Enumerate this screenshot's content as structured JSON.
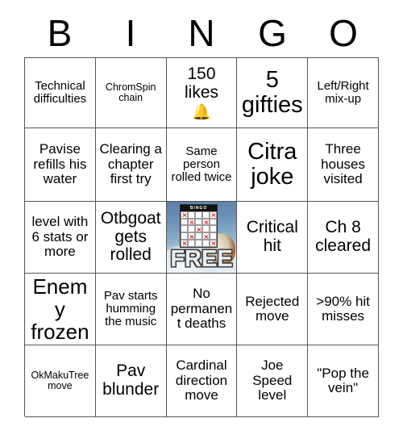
{
  "card": {
    "header_letters": [
      "B",
      "I",
      "N",
      "G",
      "O"
    ],
    "rows": [
      [
        {
          "text": "Technical difficulties",
          "size": "s"
        },
        {
          "text": "ChromSpin chain",
          "size": "xs"
        },
        {
          "text": "150 likes",
          "size": "l",
          "emoji": "🔔",
          "emoji_name": "bell-emoji"
        },
        {
          "text": "5 gifties",
          "size": "xxl"
        },
        {
          "text": "Left/Right mix-up",
          "size": "s"
        }
      ],
      [
        {
          "text": "Pavise refills his water",
          "size": "m"
        },
        {
          "text": "Clearing a chapter first try",
          "size": "m"
        },
        {
          "text": "Same person rolled twice",
          "size": "s"
        },
        {
          "text": "Citra joke",
          "size": "xxl"
        },
        {
          "text": "Three houses visited",
          "size": "m"
        }
      ],
      [
        {
          "text": "level with 6 stats or more",
          "size": "m"
        },
        {
          "text": "Otbgoat gets rolled",
          "size": "l"
        },
        {
          "text": "FREE",
          "size": "free",
          "free_space": true
        },
        {
          "text": "Critical hit",
          "size": "l"
        },
        {
          "text": "Ch 8 cleared",
          "size": "l"
        }
      ],
      [
        {
          "text": "Enemy frozen",
          "size": "xl"
        },
        {
          "text": "Pav starts humming the music",
          "size": "s"
        },
        {
          "text": "No permanent deaths",
          "size": "m"
        },
        {
          "text": "Rejected move",
          "size": "m"
        },
        {
          "text": ">90% hit misses",
          "size": "m"
        }
      ],
      [
        {
          "text": "OkMakuTree move",
          "size": "xs"
        },
        {
          "text": "Pav blunder",
          "size": "l"
        },
        {
          "text": "Cardinal direction move",
          "size": "m"
        },
        {
          "text": "Joe Speed level",
          "size": "m"
        },
        {
          "text": "\"Pop the vein\"",
          "size": "m"
        }
      ]
    ],
    "free_space": {
      "label": "FREE",
      "mini_card_header": "BINGO",
      "marked_pattern": [
        [
          1,
          0,
          0,
          0,
          1
        ],
        [
          0,
          1,
          0,
          1,
          0
        ],
        [
          0,
          0,
          1,
          0,
          0
        ],
        [
          0,
          1,
          0,
          1,
          0
        ],
        [
          1,
          0,
          0,
          0,
          1
        ]
      ]
    },
    "colors": {
      "grid_line": "#555555",
      "text": "#000000",
      "background": "#ffffff",
      "free_mark": "#e01b1b",
      "free_sky": "#6e93b8",
      "free_snow": "#eaf1f6"
    }
  }
}
